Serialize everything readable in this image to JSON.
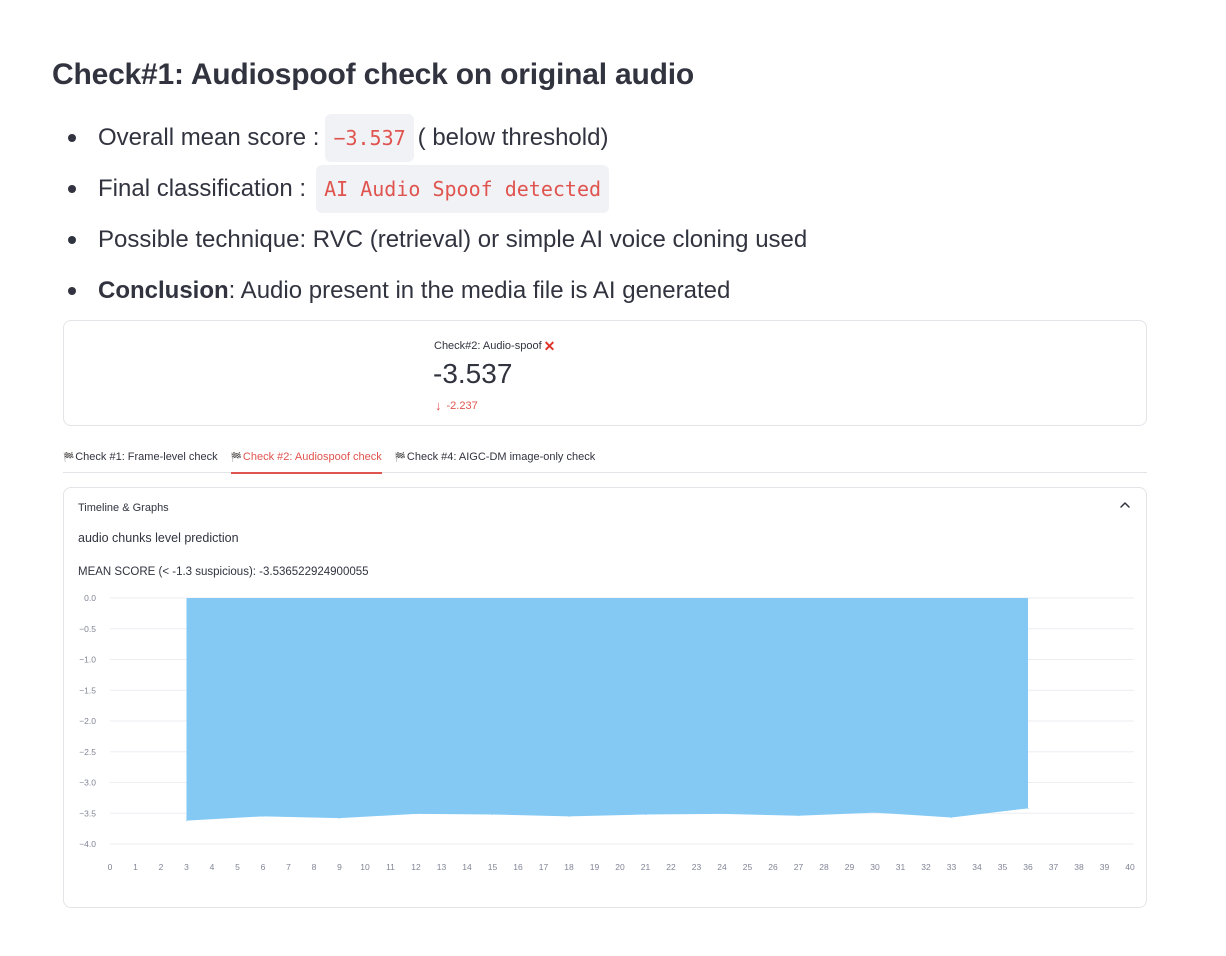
{
  "heading": "Check#1: Audiospoof check on original audio",
  "bullets": {
    "score_label": "Overall mean score :",
    "score_value": "−3.537",
    "score_note": "( below threshold)",
    "class_label": "Final classification :",
    "class_value": "AI Audio Spoof detected",
    "technique": "Possible technique: RVC (retrieval) or simple AI voice cloning used",
    "conclusion_label": "Conclusion",
    "conclusion_text": ": Audio present in the media file is AI generated"
  },
  "metric": {
    "label": "Check#2: Audio-spoof",
    "status_icon": "x-icon",
    "status_glyph": "✕",
    "value": "-3.537",
    "delta_arrow": "🡓",
    "delta": "-2.237",
    "delta_color": "#e0544f"
  },
  "tabs": [
    {
      "flag": "🏁",
      "label": "Check #1: Frame-level check",
      "active": false
    },
    {
      "flag": "🏁",
      "label": "Check #2: Audiospoof check",
      "active": true
    },
    {
      "flag": "🏁",
      "label": "Check #4: AIGC-DM image-only check",
      "active": false
    }
  ],
  "expander": {
    "title": "Timeline & Graphs",
    "subtitle": "audio chunks level prediction",
    "mean_text": "MEAN SCORE (< -1.3 suspicious): -3.536522924900055"
  },
  "chart_data": {
    "type": "area",
    "x": [
      3,
      6,
      9,
      12,
      15,
      18,
      21,
      24,
      27,
      30,
      33,
      36
    ],
    "values": [
      -3.62,
      -3.55,
      -3.58,
      -3.51,
      -3.52,
      -3.55,
      -3.52,
      -3.51,
      -3.54,
      -3.49,
      -3.57,
      -3.42
    ],
    "xlim": [
      0,
      40
    ],
    "ylim": [
      -4.0,
      0.0
    ],
    "xticks": [
      0,
      1,
      2,
      3,
      4,
      5,
      6,
      7,
      8,
      9,
      10,
      11,
      12,
      13,
      14,
      15,
      16,
      17,
      18,
      19,
      20,
      21,
      22,
      23,
      24,
      25,
      26,
      27,
      28,
      29,
      30,
      31,
      32,
      33,
      34,
      35,
      36,
      37,
      38,
      39,
      40
    ],
    "yticks": [
      0.0,
      -0.5,
      -1.0,
      -1.5,
      -2.0,
      -2.5,
      -3.0,
      -3.5,
      -4.0
    ],
    "ytick_labels": [
      "0.0",
      "−0.5",
      "−1.0",
      "−1.5",
      "−2.0",
      "−2.5",
      "−3.0",
      "−3.5",
      "−4.0"
    ],
    "fill_color": "#83c9f4",
    "grid": true
  },
  "colors": {
    "accent": "#e0544f",
    "area": "#83c9f4"
  }
}
